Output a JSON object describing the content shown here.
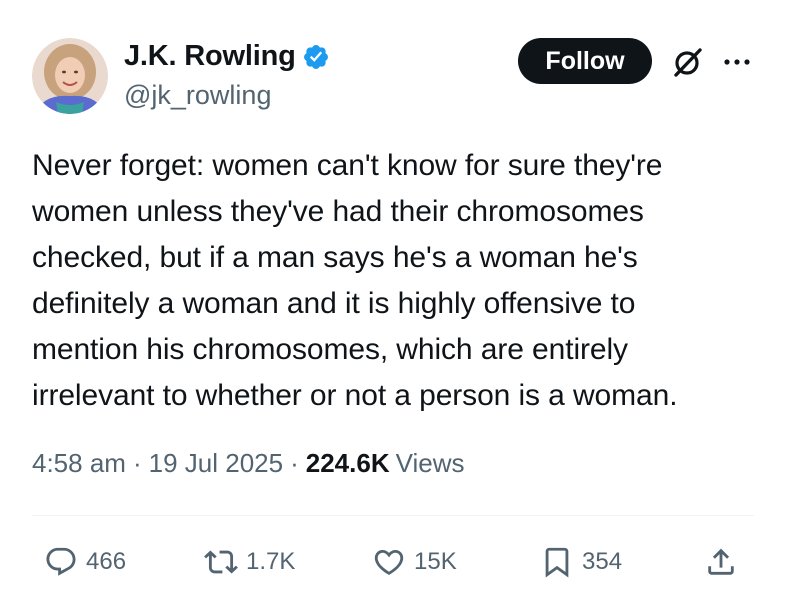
{
  "author": {
    "display_name": "J.K. Rowling",
    "handle": "@jk_rowling",
    "verified": true
  },
  "header": {
    "follow_label": "Follow"
  },
  "tweet": {
    "text": "Never forget: women can't know for sure they're\nwomen unless they've had their chromosomes\nchecked, but if a man says he's a woman he's\ndefinitely a woman and it is highly offensive to\nmention his chromosomes, which are entirely\nirrelevant to whether or not a person is a woman.",
    "time": "4:58 am",
    "date": "19 Jul 2025",
    "views_count": "224.6K",
    "views_label": "Views"
  },
  "actions": {
    "replies": "466",
    "reposts": "1.7K",
    "likes": "15K",
    "bookmarks": "354"
  },
  "colors": {
    "text_primary": "#0f1419",
    "text_secondary": "#536471",
    "verified_blue": "#1d9bf0",
    "follow_bg": "#0f1419"
  },
  "icons": {
    "verified": "verified-badge-icon",
    "grok": "grok-icon",
    "more": "more-dots-icon",
    "reply": "reply-bubble-icon",
    "repost": "repost-arrows-icon",
    "like": "heart-icon",
    "bookmark": "bookmark-icon",
    "share": "share-upload-icon"
  }
}
